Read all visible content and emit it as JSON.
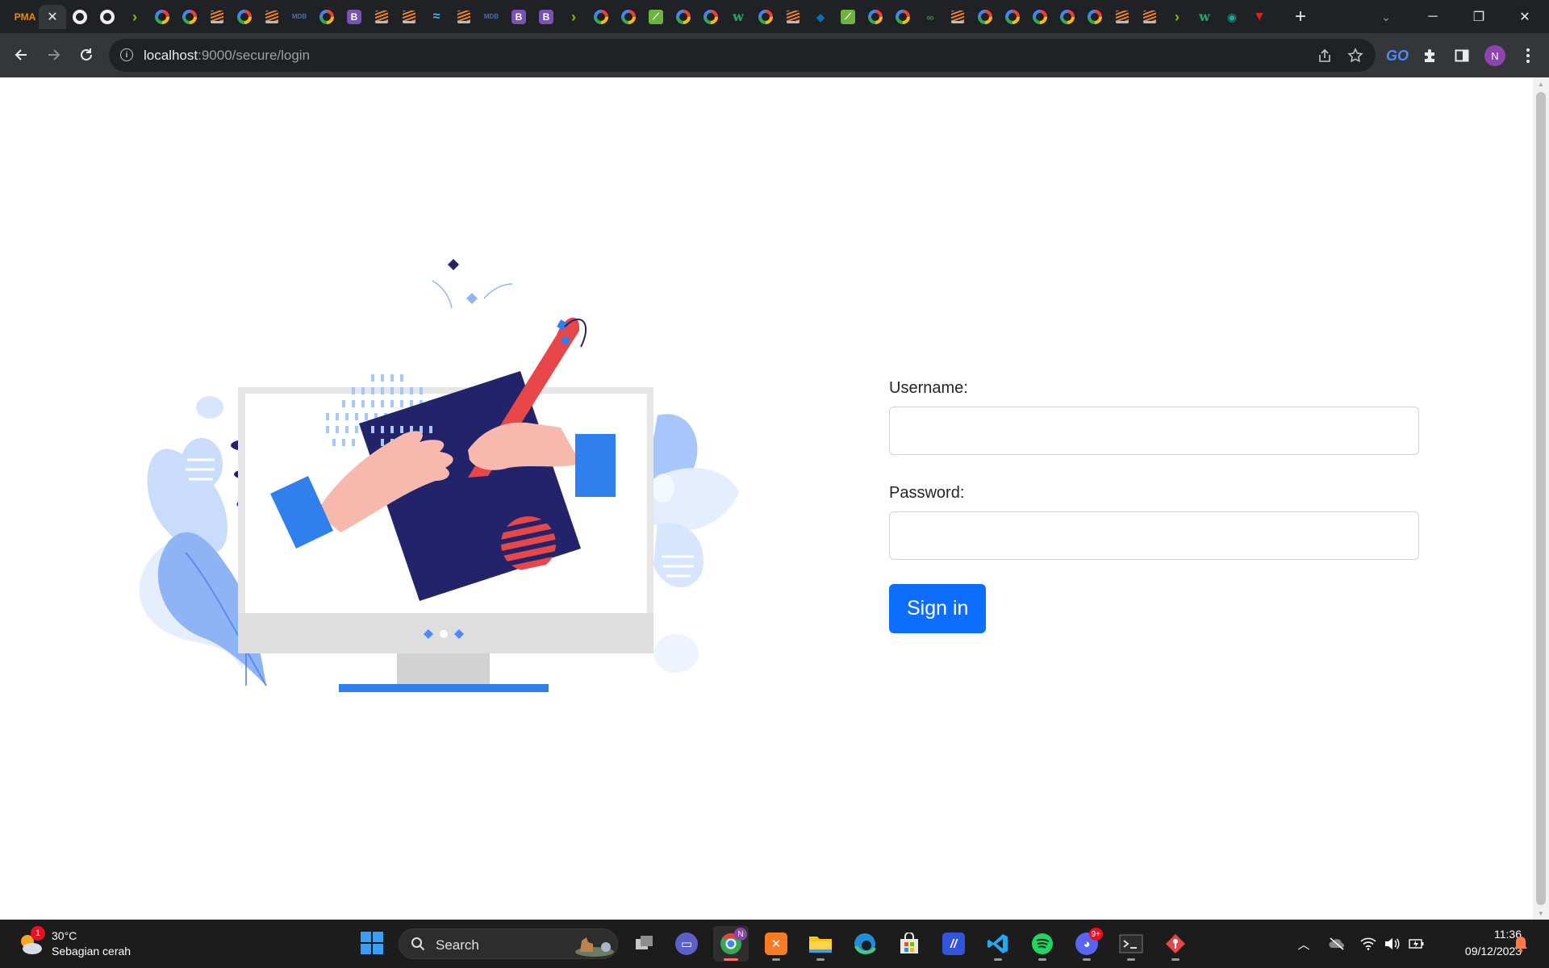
{
  "browser": {
    "tabs": [
      {
        "icon": "phpmyadmin-icon",
        "label": "PMA",
        "active": false
      },
      {
        "icon": "close-icon",
        "label": "✕",
        "active": true
      },
      {
        "icon": "github-icon",
        "label": "",
        "active": false
      },
      {
        "icon": "github-icon",
        "label": "",
        "active": false
      },
      {
        "icon": "arrow-icon",
        "label": "›",
        "active": false
      },
      {
        "icon": "google-icon",
        "label": "",
        "active": false
      },
      {
        "icon": "google-icon",
        "label": "",
        "active": false
      },
      {
        "icon": "stackoverflow-icon",
        "label": "",
        "active": false
      },
      {
        "icon": "google-icon",
        "label": "",
        "active": false
      },
      {
        "icon": "stackoverflow-icon",
        "label": "",
        "active": false
      },
      {
        "icon": "mdb-icon",
        "label": "MDB",
        "active": false
      },
      {
        "icon": "google-icon",
        "label": "",
        "active": false
      },
      {
        "icon": "bootstrap-icon",
        "label": "B",
        "active": false
      },
      {
        "icon": "stackoverflow-icon",
        "label": "",
        "active": false
      },
      {
        "icon": "stackoverflow-icon",
        "label": "",
        "active": false
      },
      {
        "icon": "tailwind-icon",
        "label": "≈",
        "active": false
      },
      {
        "icon": "stackoverflow-icon",
        "label": "",
        "active": false
      },
      {
        "icon": "mdb-icon",
        "label": "MDB",
        "active": false
      },
      {
        "icon": "bootstrap-icon",
        "label": "B",
        "active": false
      },
      {
        "icon": "bootstrap-icon",
        "label": "B",
        "active": false
      },
      {
        "icon": "arrow-icon",
        "label": "›",
        "active": false
      },
      {
        "icon": "google-icon",
        "label": "",
        "active": false
      },
      {
        "icon": "google-icon",
        "label": "",
        "active": false
      },
      {
        "icon": "spring-icon",
        "label": "⟋",
        "active": false
      },
      {
        "icon": "google-icon",
        "label": "",
        "active": false
      },
      {
        "icon": "google-icon",
        "label": "",
        "active": false
      },
      {
        "icon": "w3schools-icon",
        "label": "w",
        "active": false
      },
      {
        "icon": "google-icon",
        "label": "",
        "active": false
      },
      {
        "icon": "stackoverflow-icon",
        "label": "",
        "active": false
      },
      {
        "icon": "blue-diamond-icon",
        "label": "◆",
        "active": false
      },
      {
        "icon": "spring-icon",
        "label": "⟋",
        "active": false
      },
      {
        "icon": "google-icon",
        "label": "",
        "active": false
      },
      {
        "icon": "google-icon",
        "label": "",
        "active": false
      },
      {
        "icon": "geeksforgeeks-icon",
        "label": "∞",
        "active": false
      },
      {
        "icon": "stackoverflow-icon",
        "label": "",
        "active": false
      },
      {
        "icon": "google-icon",
        "label": "",
        "active": false
      },
      {
        "icon": "google-icon",
        "label": "",
        "active": false
      },
      {
        "icon": "google-icon",
        "label": "",
        "active": false
      },
      {
        "icon": "google-icon",
        "label": "",
        "active": false
      },
      {
        "icon": "google-icon",
        "label": "",
        "active": false
      },
      {
        "icon": "stackoverflow-icon",
        "label": "",
        "active": false
      },
      {
        "icon": "stackoverflow-icon",
        "label": "",
        "active": false
      },
      {
        "icon": "arrow-icon",
        "label": "›",
        "active": false
      },
      {
        "icon": "w3schools-icon",
        "label": "w",
        "active": false
      },
      {
        "icon": "eye-icon",
        "label": "◉",
        "active": false
      },
      {
        "icon": "vivaldi-icon",
        "label": "▼",
        "active": false
      }
    ],
    "new_tab": "+",
    "tab_search": "⌄",
    "window": {
      "minimize": "─",
      "restore": "❐",
      "close": "✕"
    },
    "url_host": "localhost",
    "url_path": ":9000/secure/login",
    "profile_initial": "N"
  },
  "login": {
    "username_label": "Username:",
    "username_value": "",
    "password_label": "Password:",
    "password_value": "",
    "submit_label": "Sign in"
  },
  "taskbar": {
    "weather_temp": "30°C",
    "weather_desc": "Sebagian cerah",
    "weather_badge": "1",
    "search_label": "Search",
    "chrome_badge": "N",
    "discord_badge": "9+",
    "time": "11:36",
    "date": "09/12/2023"
  },
  "colors": {
    "primary_button": "#0d6efd",
    "illustration_navy": "#23236b",
    "illustration_blue": "#2f80ed",
    "illustration_red": "#e8474a",
    "illustration_skin": "#f7b9ad"
  }
}
